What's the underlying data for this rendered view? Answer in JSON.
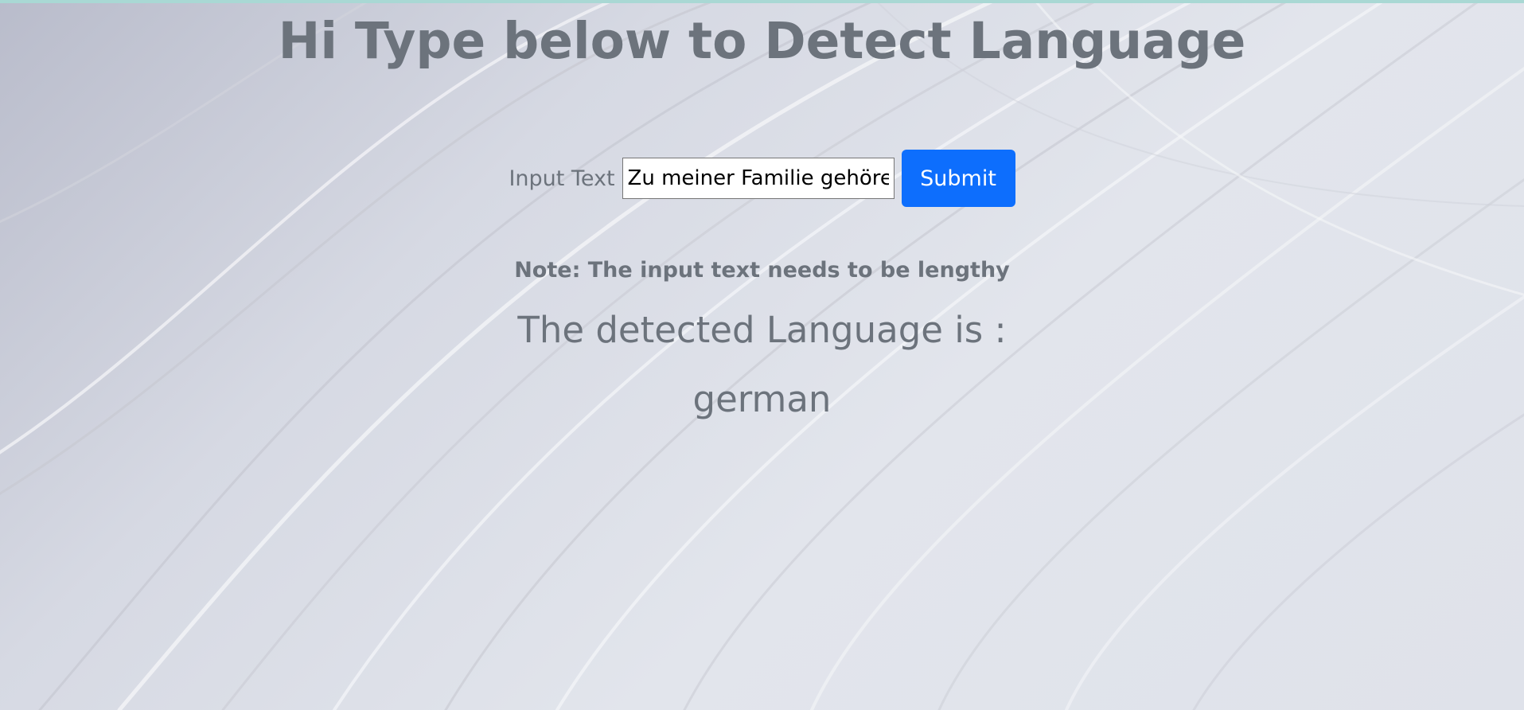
{
  "page": {
    "title": "Hi Type below to Detect Language"
  },
  "form": {
    "input_label": "Input Text",
    "input_value": "Zu meiner Familie gehören",
    "submit_label": "Submit"
  },
  "result": {
    "note": "Note: The input text needs to be lengthy",
    "detected_label": "The detected Language is :",
    "detected_language": "german"
  },
  "colors": {
    "text": "#6c737c",
    "button": "#0d6efd",
    "button_text": "#ffffff",
    "top_strip": "#a9d8d4"
  }
}
